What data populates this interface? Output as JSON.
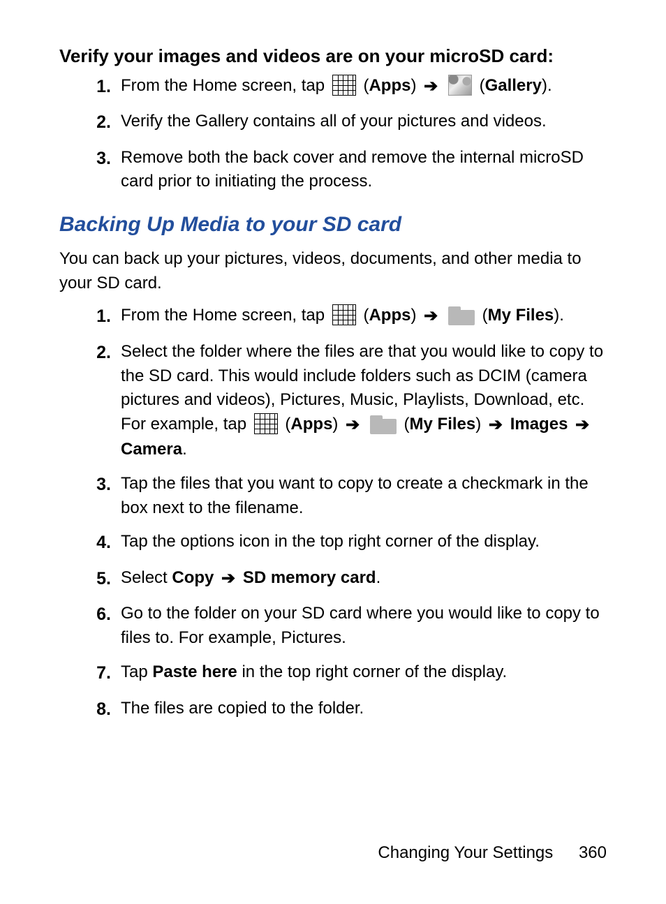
{
  "section1": {
    "lead": "Verify your images and videos are on your microSD card:",
    "steps": [
      {
        "num": "1.",
        "pre": "From the Home screen, tap ",
        "label_apps": "Apps",
        "label_gallery": "Gallery",
        "post_period": "."
      },
      {
        "num": "2.",
        "text": "Verify the Gallery contains all of your pictures and videos."
      },
      {
        "num": "3.",
        "text": "Remove both the back cover and remove the internal microSD card prior to initiating the process."
      }
    ]
  },
  "section2": {
    "heading": "Backing Up Media to your SD card",
    "intro": "You can back up your pictures, videos, documents, and other media to your SD card.",
    "steps": [
      {
        "num": "1.",
        "pre": "From the Home screen, tap ",
        "label_apps": "Apps",
        "label_myfiles": "My Files",
        "post_period": "."
      },
      {
        "num": "2.",
        "pre": "Select the folder where the files are that you would like to copy to the SD card. This would include folders such as DCIM (camera pictures and videos), Pictures, Music, Playlists, Download, etc. For example, tap ",
        "label_apps": "Apps",
        "label_myfiles": "My Files",
        "label_images": "Images",
        "label_camera": "Camera",
        "post_period": "."
      },
      {
        "num": "3.",
        "text": "Tap the files that you want to copy to create a checkmark in the box next to the filename."
      },
      {
        "num": "4.",
        "text": "Tap the options icon in the top right corner of the display."
      },
      {
        "num": "5.",
        "pre": "Select ",
        "label_copy": "Copy",
        "label_sd": "SD memory card",
        "post_period": "."
      },
      {
        "num": "6.",
        "text": "Go to the folder on your SD card where you would like to copy to files to. For example, Pictures."
      },
      {
        "num": "7.",
        "pre": "Tap ",
        "label_paste": "Paste here",
        "post": " in the top right corner of the display."
      },
      {
        "num": "8.",
        "text": "The files are copied to the folder."
      }
    ]
  },
  "footer": {
    "chapter": "Changing Your Settings",
    "page": "360"
  },
  "arrow_glyph": "➔"
}
